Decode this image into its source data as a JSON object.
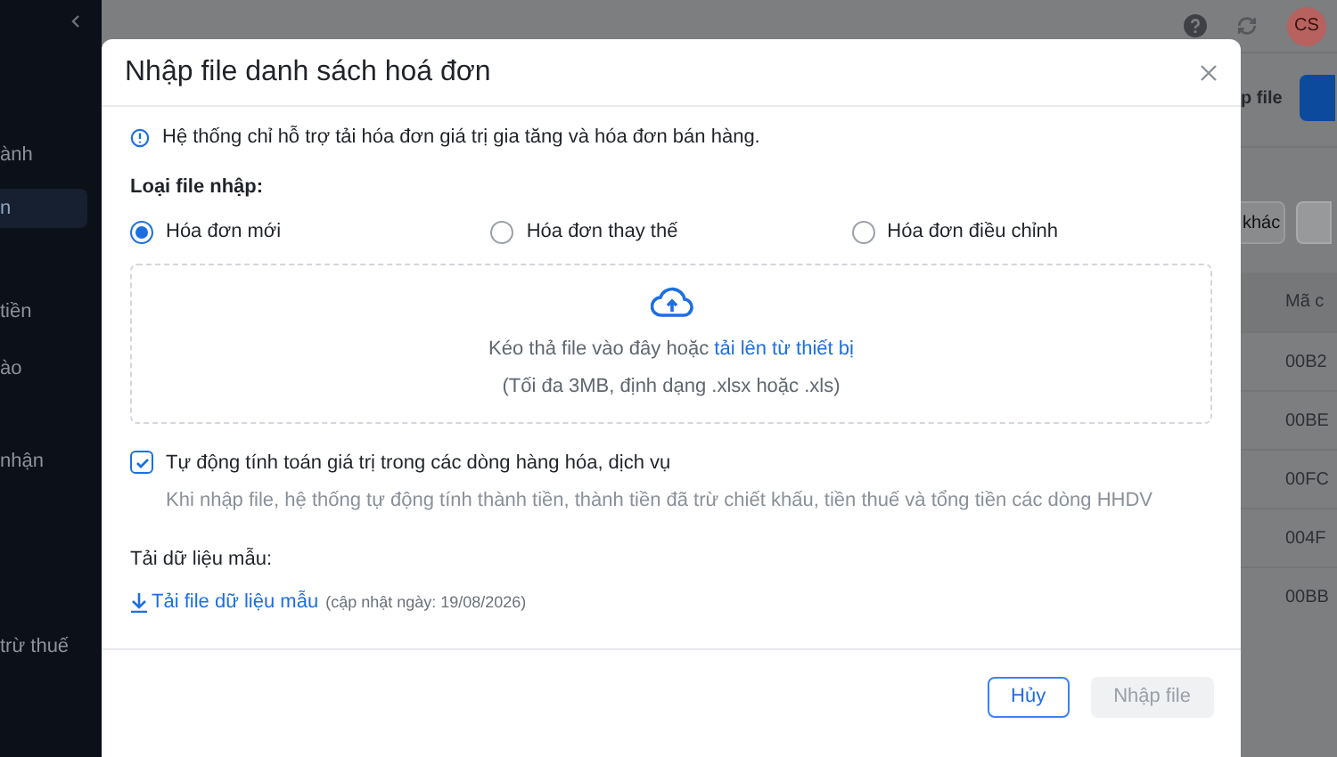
{
  "sidebar": {
    "items": [
      {
        "label": "ành",
        "selected": false
      },
      {
        "label": "n",
        "selected": true
      },
      {
        "label": "tiền",
        "selected": false
      },
      {
        "label": "ào",
        "selected": false
      },
      {
        "label": "nhận",
        "selected": false
      },
      {
        "label": "trừ thuế",
        "selected": false
      }
    ]
  },
  "top_bar": {
    "avatar": "CS"
  },
  "background": {
    "import_button": "p file",
    "filter_button": "khác",
    "column_header": "Mã c",
    "rows": [
      "00B2",
      "00BE",
      "00FC",
      "004F",
      "00BB"
    ]
  },
  "dialog": {
    "title": "Nhập file danh sách hoá đơn",
    "info": "Hệ thống chỉ hỗ trợ tải hóa đơn giá trị gia tăng và hóa đơn bán hàng.",
    "file_type_label": "Loại file nhập:",
    "file_types": [
      {
        "label": "Hóa đơn mới",
        "selected": true
      },
      {
        "label": "Hóa đơn thay thế",
        "selected": false
      },
      {
        "label": "Hóa đơn điều chỉnh",
        "selected": false
      }
    ],
    "dropzone": {
      "text": "Kéo thả file vào đây hoặc",
      "link": "tải lên từ thiết bị",
      "hint": "(Tối đa 3MB, định dạng .xlsx hoặc .xls)"
    },
    "auto_calc": {
      "label": "Tự động tính toán giá trị trong các dòng hàng hóa, dịch vụ",
      "description": "Khi nhập file, hệ thống tự động tính thành tiền, thành tiền đã trừ chiết khấu, tiền thuế và tổng tiền các dòng HHDV",
      "checked": true
    },
    "sample_label": "Tải dữ liệu mẫu:",
    "sample_link": "Tải file dữ liệu mẫu",
    "sample_note": "(cập nhật ngày: 19/08/2026)",
    "buttons": [
      {
        "label": "Hủy",
        "kind": "secondary",
        "disabled": false
      },
      {
        "label": "Nhập file",
        "kind": "primary",
        "disabled": true
      }
    ]
  }
}
